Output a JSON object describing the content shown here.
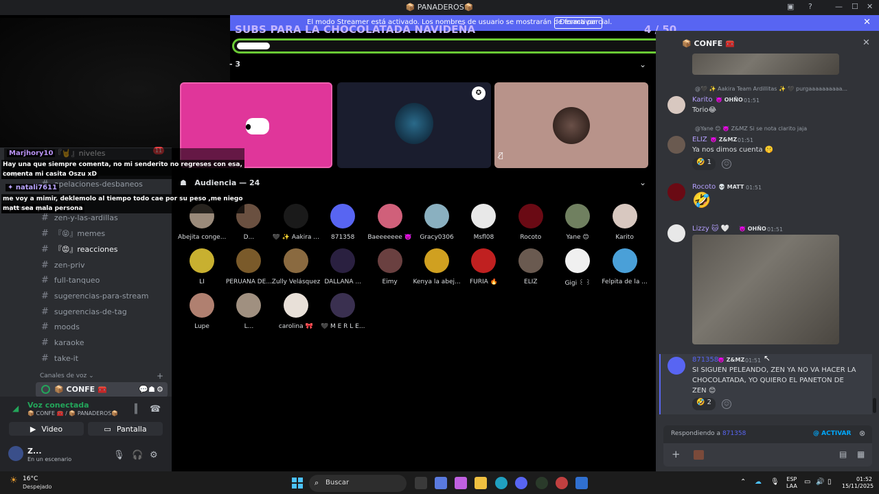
{
  "window": {
    "title": "📦 PANADEROS📦"
  },
  "streamer_banner": {
    "message": "El modo Streamer está activado. Los nombres de usuario se mostrarán de forma parcial.",
    "button": "Desactivar"
  },
  "goal": {
    "title": "SUBS PARA LA CHOCOLATADA NAVIDEÑA",
    "current": "4",
    "total": "/ 50",
    "progress": 0.08
  },
  "chat_overlay": [
    {
      "user": "Marjhory10",
      "text_line1": "Hay una que siempre comenta, no mi senderito no regreses con esa, luego",
      "text_line2": "comenta mi casita Oszu xD"
    },
    {
      "user": "✦ natali7611",
      "text_line1": "me voy a mimir, deklemolo al tiempo todo cae por su peso ,me niego a pensar que",
      "text_line2": "matt sea mala persona"
    }
  ],
  "sidebar": {
    "channels": [
      {
        "label": "『🤘』niveles",
        "badge": "11",
        "bright": true
      },
      {
        "label": "apelaciones-desbaneos",
        "bright": false
      },
      {
        "label": "zen-y-las-ardillas",
        "bright": false
      },
      {
        "label": "『😝』memes",
        "bright": false
      },
      {
        "label": "『😡』reacciones",
        "bright": true
      },
      {
        "label": "zen-priv",
        "bright": false
      },
      {
        "label": "full-tanqueo",
        "bright": false
      },
      {
        "label": "sugerencias-para-stream",
        "bright": false
      },
      {
        "label": "sugerencias-de-tag",
        "bright": false
      },
      {
        "label": "moods",
        "bright": false
      },
      {
        "label": "karaoke",
        "bright": false
      },
      {
        "label": "take-it",
        "bright": false
      }
    ],
    "voice_section": "Canales de voz ⌄",
    "voice_channel": "📦 CONFE 🧰",
    "voice_connected": "Voz conectada",
    "voice_path": "📦 CONFE 🧰 / 📦 PANADEROS📦",
    "video_label": "Video",
    "screen_label": "Pantalla",
    "user_name": "Z...",
    "user_status": "En un escenario"
  },
  "stage": {
    "header": "- 3",
    "audience_header": "Audiencia — 24",
    "audience": [
      {
        "name": "Abejita conge...",
        "color": "#9a8a7a"
      },
      {
        "name": "D...",
        "color": "#6a5040"
      },
      {
        "name": "🖤 ✨ Aakira ...",
        "color": "#1a1a1a"
      },
      {
        "name": "871358",
        "color": "#5865f2"
      },
      {
        "name": "Baeeeeeee 👿",
        "color": "#d0607a"
      },
      {
        "name": "Gracy0306",
        "color": "#8ab0c0"
      },
      {
        "name": "Msfl08",
        "color": "#e8e8e8"
      },
      {
        "name": "Rocoto",
        "color": "#6a0a14"
      },
      {
        "name": "Yane 😊",
        "color": "#708060"
      },
      {
        "name": "Karito",
        "color": "#d8c8c0"
      },
      {
        "name": "LI",
        "color": "#c8b030"
      },
      {
        "name": "PERUANA DE...",
        "color": "#7a5a2a"
      },
      {
        "name": "Zully Velásquez",
        "color": "#8a6a40"
      },
      {
        "name": "DALLANA ...",
        "color": "#2a2040"
      },
      {
        "name": "Eimy",
        "color": "#6a4040"
      },
      {
        "name": "Kenya la abej...",
        "color": "#d0a020"
      },
      {
        "name": "FURIA 🔥",
        "color": "#c02020"
      },
      {
        "name": "ELIZ",
        "color": "#6a5a50"
      },
      {
        "name": "Gigi ꒰ ꒱",
        "color": "#f0f0f0"
      },
      {
        "name": "Felpita de la ...",
        "color": "#4aa0d8"
      },
      {
        "name": "Lupe",
        "color": "#b08070"
      },
      {
        "name": "L...",
        "color": "#a09080"
      },
      {
        "name": "carolina 🎀",
        "color": "#e8e0d8"
      },
      {
        "name": "🖤 M E R L E...",
        "color": "#3a3050"
      }
    ]
  },
  "right_panel": {
    "title": "📦 CONFE 🧰",
    "messages": [
      {
        "reply": "@🖤 ✨ Aakira Team Ardillitas ✨ 🖤 purgaaaaaaaaaa...",
        "user": "Karito",
        "user_color": "#b5a0ff",
        "tag": "👿 OHÑO",
        "time": "01:51",
        "text": "Torio😂"
      },
      {
        "reply": "@Yane 😊  👿 Z&MZ  Si se nota clarito jaja",
        "user": "ELIZ",
        "user_color": "#b5a0ff",
        "tag": "👿 Z&MZ",
        "time": "01:51",
        "text": "Ya nos dimos cuenta 🤫",
        "reaction": "🤣 1"
      },
      {
        "user": "Rocoto",
        "user_color": "#b5a0ff",
        "tag": "💀 MATT",
        "time": "01:51",
        "text": "🤣"
      },
      {
        "user": "Lizzy 🐱 🤍",
        "user_color": "#b5a0ff",
        "tag": "👿 OHÑO",
        "time": "01:51",
        "text": ""
      },
      {
        "user": "871358",
        "user_color": "#5865f2",
        "tag": "👿 Z&MZ",
        "time": "01:51",
        "text": "SI SIGUEN PELEANDO, ZEN YA NO VA HACER LA CHOCOLATADA, YO QUIERO EL PANETON DE ZEN 😊",
        "reaction": "🤣 2"
      }
    ],
    "replying_to_label": "Respondiendo a",
    "replying_to_user": "871358",
    "activate_label": "@ ACTIVAR"
  },
  "taskbar": {
    "temp": "16°C",
    "condition": "Despejado",
    "search": "Buscar",
    "lang1": "ESP",
    "lang2": "LAA",
    "time": "01:52",
    "date": "15/11/2025"
  }
}
